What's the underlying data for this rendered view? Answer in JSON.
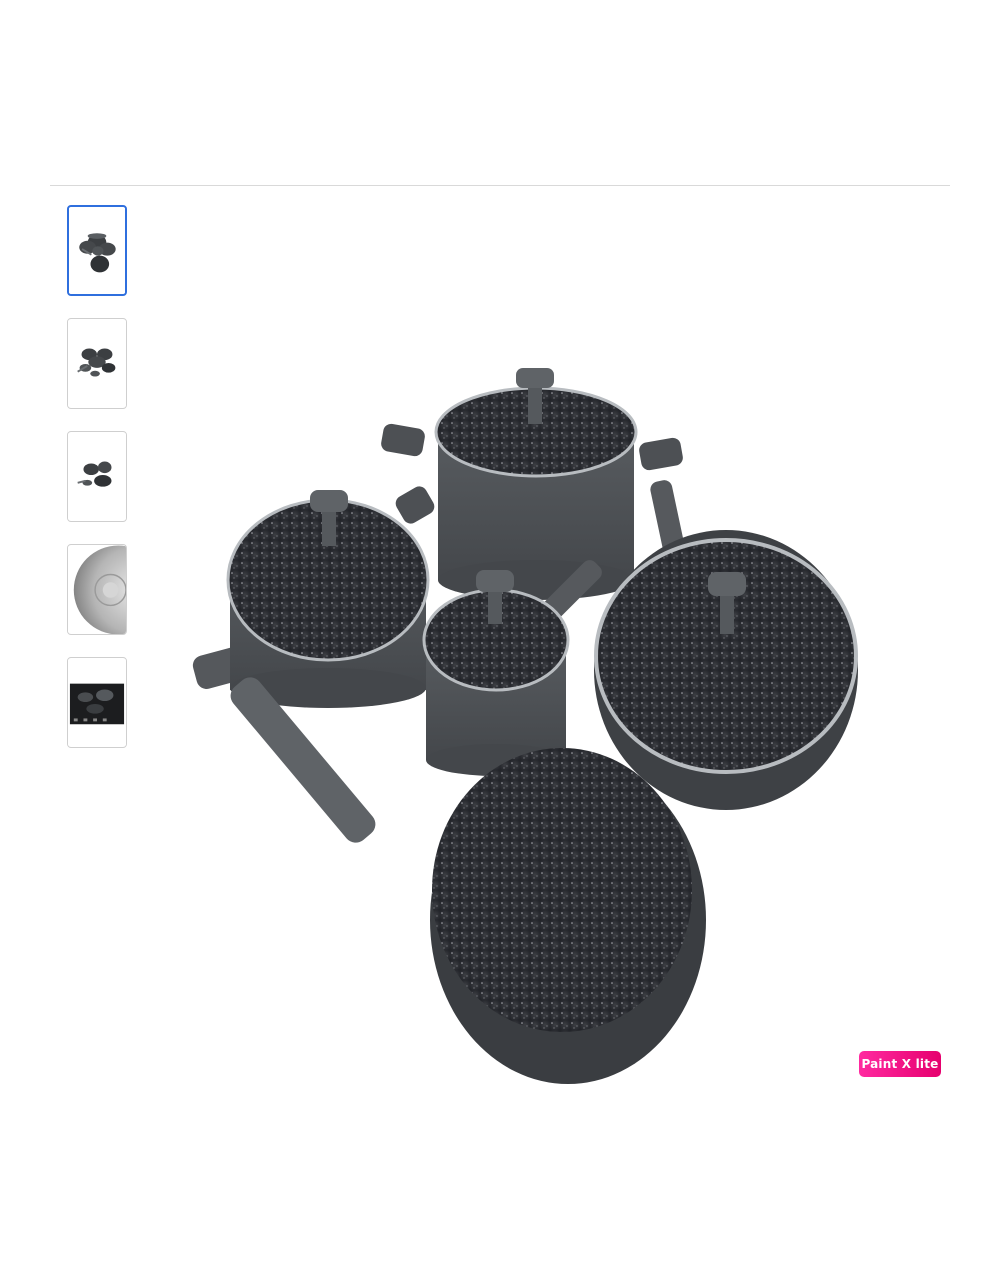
{
  "gallery": {
    "thumbnails": [
      {
        "name": "cookware-set-front",
        "selected": true
      },
      {
        "name": "cookware-set-overview",
        "selected": false
      },
      {
        "name": "cookware-set-side",
        "selected": false
      },
      {
        "name": "pan-bottom-closeup",
        "selected": false
      },
      {
        "name": "cookware-on-stove",
        "selected": false
      }
    ],
    "accent_color": "#2f6fde"
  },
  "watermark": {
    "text": "Paint X lite"
  }
}
